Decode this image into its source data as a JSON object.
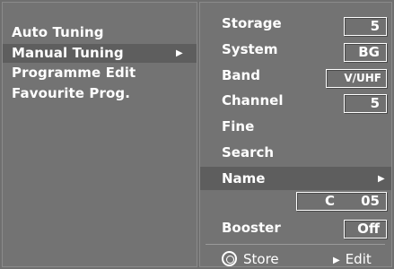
{
  "left_menu": {
    "items": [
      {
        "label": "Auto Tuning",
        "selected": false
      },
      {
        "label": "Manual Tuning",
        "selected": true
      },
      {
        "label": "Programme Edit",
        "selected": false
      },
      {
        "label": "Favourite Prog.",
        "selected": false
      }
    ],
    "submenu_arrow": "▶"
  },
  "right_menu": {
    "storage": {
      "label": "Storage",
      "value": "5"
    },
    "system": {
      "label": "System",
      "value": "BG"
    },
    "band": {
      "label": "Band",
      "value": "V/UHF"
    },
    "channel": {
      "label": "Channel",
      "value": "5"
    },
    "fine": {
      "label": "Fine"
    },
    "search": {
      "label": "Search"
    },
    "name": {
      "label": "Name",
      "arrow": "▶",
      "value_prefix": "C",
      "value_number": "05"
    },
    "booster": {
      "label": "Booster",
      "value": "Off"
    }
  },
  "footer": {
    "store_label": "Store",
    "edit_label": "Edit",
    "edit_arrow": "▶"
  },
  "colors": {
    "background": "#6f6f6f",
    "panel": "#737373",
    "selected_row": "#5e5e5e",
    "text": "#ffffff"
  },
  "icons": {
    "store": "circle-target-icon",
    "edit": "play-triangle-icon"
  }
}
